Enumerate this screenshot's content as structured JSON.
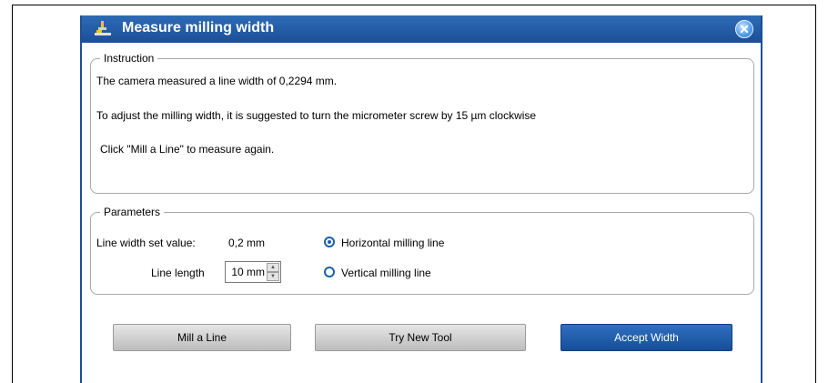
{
  "dialog": {
    "title": "Measure milling width"
  },
  "instruction": {
    "legend": "Instruction",
    "line1": "The camera measured a line width of 0,2294 mm.",
    "line2": "To adjust the milling width, it is suggested to turn the micrometer screw by 15 µm clockwise",
    "line3": "Click \"Mill a Line\" to measure again."
  },
  "parameters": {
    "legend": "Parameters",
    "line_width_label": "Line width set value:",
    "line_width_value": "0,2 mm",
    "line_length_label": "Line length",
    "line_length_value": "10 mm",
    "radio_options": [
      {
        "label": "Horizontal milling line",
        "selected": true
      },
      {
        "label": "Vertical milling line",
        "selected": false
      }
    ]
  },
  "buttons": {
    "mill": "Mill a Line",
    "try_tool": "Try New Tool",
    "accept": "Accept Width"
  },
  "colors": {
    "accent": "#1b4f96",
    "primary_button": "#174e98"
  }
}
